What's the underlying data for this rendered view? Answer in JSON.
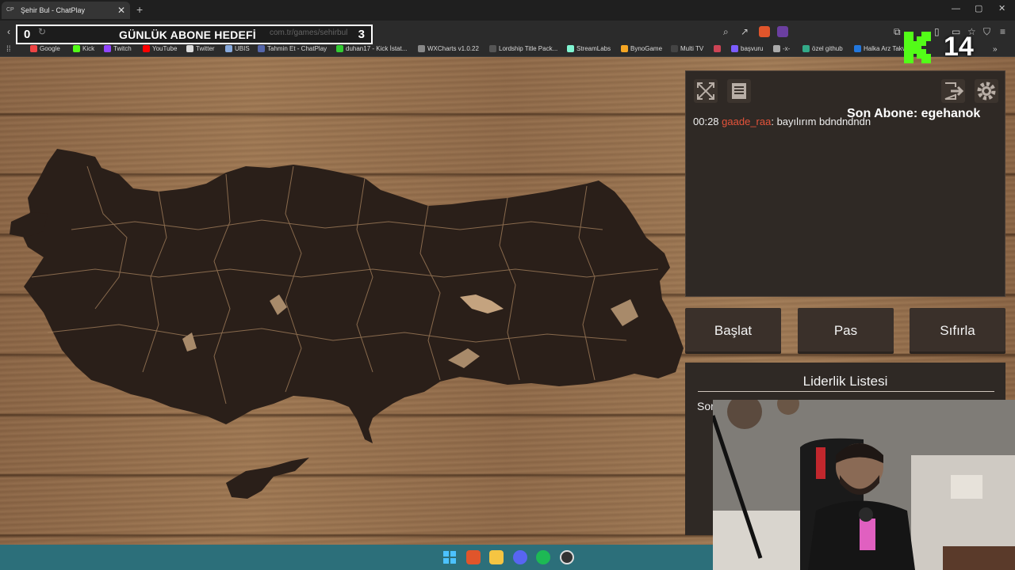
{
  "browser": {
    "tab_favicon": "CP",
    "tab_title": "Şehir Bul - ChatPlay",
    "url": "com.tr/games/sehirbul",
    "bookmarks": [
      {
        "label": "Google",
        "color": "#e44"
      },
      {
        "label": "Kick",
        "color": "#53fc18"
      },
      {
        "label": "Twitch",
        "color": "#9146ff"
      },
      {
        "label": "YouTube",
        "color": "#ff0000"
      },
      {
        "label": "Twitter",
        "color": "#dddddd"
      },
      {
        "label": "UBIS",
        "color": "#88aadd"
      },
      {
        "label": "Tahmin Et - ChatPlay",
        "color": "#5566aa"
      },
      {
        "label": "duhan17 - Kick İstat...",
        "color": "#3c3"
      },
      {
        "label": "WXCharts v1.0.22",
        "color": "#888"
      },
      {
        "label": "Lordship Title Pack...",
        "color": "#555"
      },
      {
        "label": "StreamLabs",
        "color": "#80f5d2"
      },
      {
        "label": "BynoGame",
        "color": "#f5a623"
      },
      {
        "label": "Multi TV",
        "color": "#444"
      },
      {
        "label": "",
        "color": "#cc4455"
      },
      {
        "label": "başvuru",
        "color": "#7b5cff"
      },
      {
        "label": "-x-",
        "color": "#aaa"
      },
      {
        "label": "özel github",
        "color": "#3a8"
      },
      {
        "label": "Halka Arz Takvi",
        "color": "#2277dd"
      }
    ]
  },
  "overlay": {
    "goal_current": "0",
    "goal_title": "GÜNLÜK ABONE HEDEFİ",
    "goal_target": "3",
    "kick_count": "14",
    "last_sub": "Son Abone: egehanok"
  },
  "game": {
    "chat": {
      "time": "00:28",
      "user": "gaade_raa",
      "message": ": bayılırım bdndndndn"
    },
    "buttons": {
      "start": "Başlat",
      "pass": "Pas",
      "reset": "Sıfırla"
    },
    "leaderboard": {
      "title": "Liderlik Listesi",
      "first_fragment": "Sor"
    }
  },
  "icons": {
    "fullscreen": "fullscreen-icon",
    "list": "document-icon",
    "exit": "exit-icon",
    "settings": "gear-icon"
  },
  "colors": {
    "panel_bg": "#2f2925",
    "chat_username": "#e5533a",
    "map_fill": "#2a1f19",
    "kick_green": "#53fc18",
    "taskbar": "#2c6f7a"
  }
}
